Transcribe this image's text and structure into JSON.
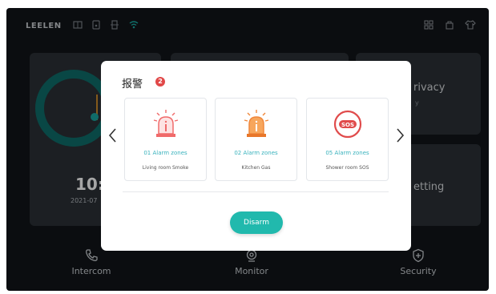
{
  "brand": "LEELEN",
  "dashboard": {
    "time": "10:",
    "date": "2021-07",
    "privacy_label": "rivacy",
    "privacy_sub": "y",
    "setting_label": "etting"
  },
  "bottom_nav": [
    {
      "label": "Intercom",
      "icon": "phone-icon"
    },
    {
      "label": "Monitor",
      "icon": "camera-icon"
    },
    {
      "label": "Security",
      "icon": "shield-icon"
    }
  ],
  "modal": {
    "title": "报警",
    "badge": "2",
    "cards": [
      {
        "zone": "01 Alarm zones",
        "desc": "Living room Smoke",
        "icon": "alarm-siren-icon",
        "accent": "#f06a6a"
      },
      {
        "zone": "02 Alarm zones",
        "desc": "Kitchen Gas",
        "icon": "alarm-siren-icon",
        "accent": "#f0883c"
      },
      {
        "zone": "05 Alarm zones",
        "desc": "Shower room SOS",
        "icon": "sos-icon",
        "accent": "#e04b4b"
      }
    ],
    "disarm_label": "Disarm"
  },
  "colors": {
    "teal": "#21b9ad",
    "zone_text": "#39b2bd",
    "badge": "#e14848",
    "background": "#121519"
  }
}
